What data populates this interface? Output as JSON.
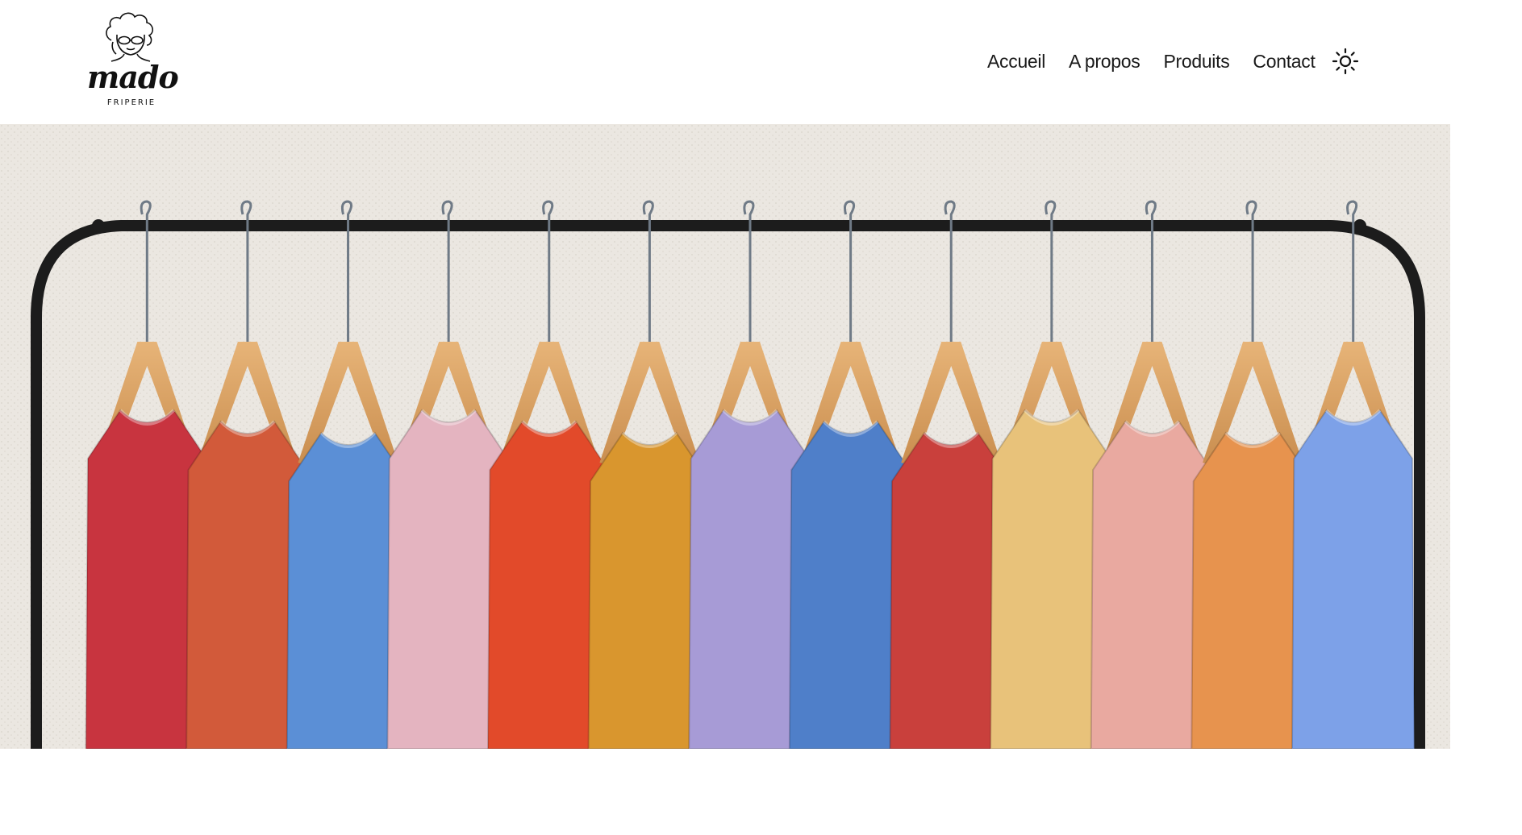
{
  "brand": {
    "name": "mado",
    "tagline": "FRIPERIE"
  },
  "nav": {
    "items": [
      {
        "label": "Accueil"
      },
      {
        "label": "A propos"
      },
      {
        "label": "Produits"
      },
      {
        "label": "Contact"
      }
    ],
    "theme_toggle_icon": "sun-icon"
  },
  "hero": {
    "image_subject": "clothing-rack-photo",
    "garment_colors": [
      "#c8343f",
      "#d25a3a",
      "#5b8fd6",
      "#e4b4c0",
      "#e24a2a",
      "#d9962e",
      "#a79bd6",
      "#4f7fc9",
      "#c9403c",
      "#e8c27a",
      "#e9a9a0",
      "#e7934e",
      "#7da1e8"
    ]
  }
}
